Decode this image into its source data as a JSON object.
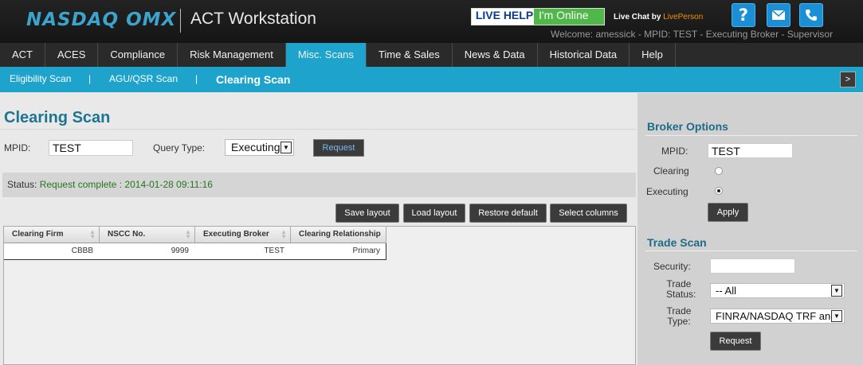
{
  "header": {
    "logo": "NASDAQ OMX",
    "app_title": "ACT Workstation",
    "live_help": "LIVE HELP",
    "online": "I'm Online",
    "live_chat": "Live Chat",
    "by": "by",
    "liveperson": "LivePerson",
    "help_icon": "question-icon",
    "welcome": "Welcome: amessick - MPID: TEST - Executing Broker - Supervisor"
  },
  "main_nav": [
    "ACT",
    "ACES",
    "Compliance",
    "Risk Management",
    "Misc. Scans",
    "Time & Sales",
    "News & Data",
    "Historical Data",
    "Help"
  ],
  "sub_nav": {
    "eligibility": "Eligibility Scan",
    "agu": "AGU/QSR Scan",
    "clearing": "Clearing Scan",
    "expand": ">"
  },
  "page": {
    "title": "Clearing Scan",
    "mpid_label": "MPID:",
    "mpid_value": "TEST",
    "query_type_label": "Query Type:",
    "query_type_value": "Executing",
    "request_label": "Request",
    "status_label": "Status:",
    "status_value": "Request complete : 2014-01-28 09:11:16"
  },
  "grid_buttons": [
    "Save layout",
    "Load layout",
    "Restore default",
    "Select columns"
  ],
  "grid": {
    "columns": [
      "Clearing Firm",
      "NSCC No.",
      "Executing Broker",
      "Clearing Relationship"
    ],
    "rows": [
      [
        "CBBB",
        "9999",
        "TEST",
        "Primary"
      ]
    ]
  },
  "broker_options": {
    "title": "Broker Options",
    "mpid_label": "MPID:",
    "mpid_value": "TEST",
    "clearing_label": "Clearing",
    "executing_label": "Executing",
    "selected": "Executing",
    "apply_label": "Apply"
  },
  "trade_scan": {
    "title": "Trade Scan",
    "security_label": "Security:",
    "security_value": "",
    "trade_status_label_1": "Trade",
    "trade_status_label_2": "Status:",
    "trade_status_value": "-- All",
    "trade_type_label_1": "Trade",
    "trade_type_label_2": "Type:",
    "trade_type_value": "FINRA/NASDAQ TRF and",
    "request_label": "Request"
  },
  "colors": {
    "accent": "#1ea4cc",
    "title": "#1e7592",
    "status_ok": "#25761e",
    "online": "#50b848"
  }
}
